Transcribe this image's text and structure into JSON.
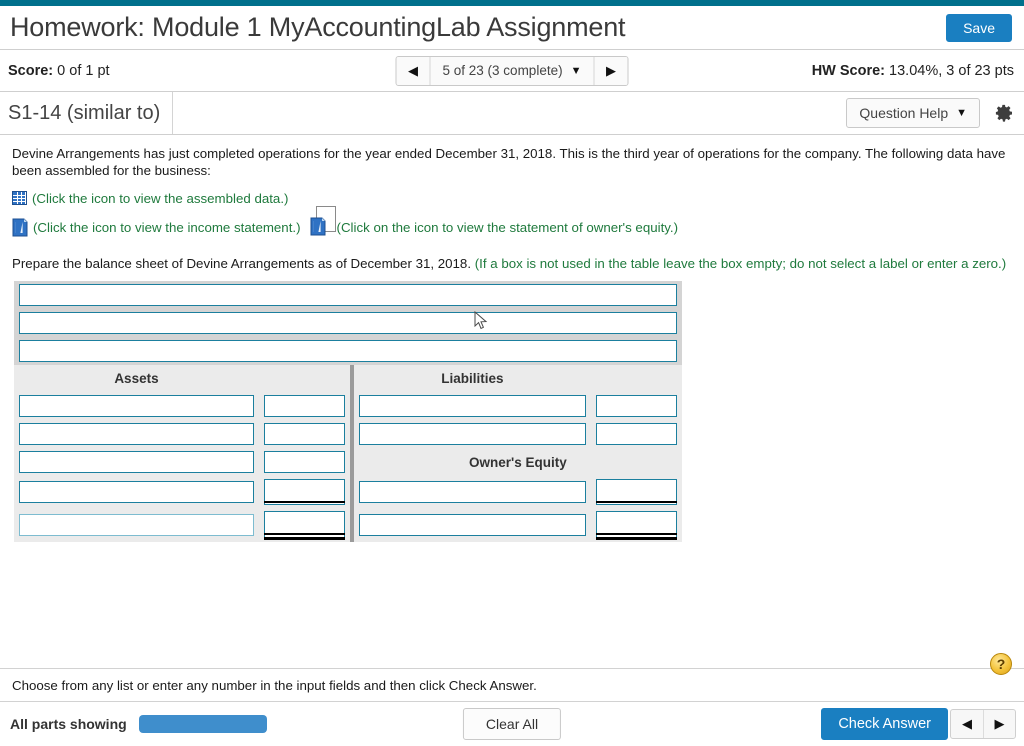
{
  "header": {
    "title": "Homework: Module 1 MyAccountingLab Assignment",
    "save_label": "Save"
  },
  "score_bar": {
    "score_label": "Score:",
    "score_value": "0 of 1 pt",
    "nav_prev_icon": "◀",
    "nav_next_icon": "▶",
    "question_selector": "5 of 23 (3 complete)",
    "caret_icon": "▼",
    "hw_score_label": "HW Score:",
    "hw_score_value": "13.04%, 3 of 23 pts"
  },
  "question_header": {
    "question_id": "S1-14 (similar to)",
    "question_help_label": "Question Help",
    "caret_icon": "▼",
    "gear_icon": "gear-icon"
  },
  "question": {
    "paragraph": "Devine Arrangements has just completed operations for the year ended December 31, 2018. This is the third year of operations for the company. The following data have been assembled for the business:",
    "links": [
      {
        "icon": "grid-icon",
        "text": "(Click the icon to view the assembled data.)"
      },
      {
        "icon": "book-icon",
        "text": "(Click the icon to view the income statement.)"
      },
      {
        "icon": "book-page-icon",
        "text": "(Click on the icon to view the statement of owner's equity.)"
      }
    ],
    "prompt_main": "Prepare the balance sheet of Devine Arrangements as of December 31, 2018.",
    "prompt_note": "(If a box is not used in the table leave the box empty; do not select a label or enter a zero.)"
  },
  "balance_sheet": {
    "title_rows": [
      "",
      "",
      ""
    ],
    "assets_header": "Assets",
    "liabilities_header": "Liabilities",
    "owners_equity_header": "Owner's Equity",
    "assets_rows": [
      {
        "label": "",
        "amount": "",
        "underline": "none"
      },
      {
        "label": "",
        "amount": "",
        "underline": "none"
      },
      {
        "label": "",
        "amount": "",
        "underline": "none"
      },
      {
        "label": "",
        "amount": "",
        "underline": "single"
      },
      {
        "label": "",
        "amount": "",
        "underline": "double"
      }
    ],
    "liabilities_rows": [
      {
        "label": "",
        "amount": "",
        "underline": "none"
      },
      {
        "label": "",
        "amount": "",
        "underline": "none"
      }
    ],
    "equity_rows": [
      {
        "label": "",
        "amount": "",
        "underline": "single"
      },
      {
        "label": "",
        "amount": "",
        "underline": "double"
      }
    ]
  },
  "footer": {
    "hint": "Choose from any list or enter any number in the input fields and then click Check Answer.",
    "help_icon": "?",
    "parts_label": "All parts showing",
    "clear_all_label": "Clear All",
    "check_answer_label": "Check Answer",
    "prev_icon": "◀",
    "next_icon": "▶"
  },
  "colors": {
    "top_stripe": "#00708c",
    "primary_blue": "#1a7fc1",
    "link_green": "#1f7a3d",
    "input_border": "#1b7f9e",
    "progress_bar": "#3f8ecc",
    "help_gold": "#f4c33a"
  }
}
